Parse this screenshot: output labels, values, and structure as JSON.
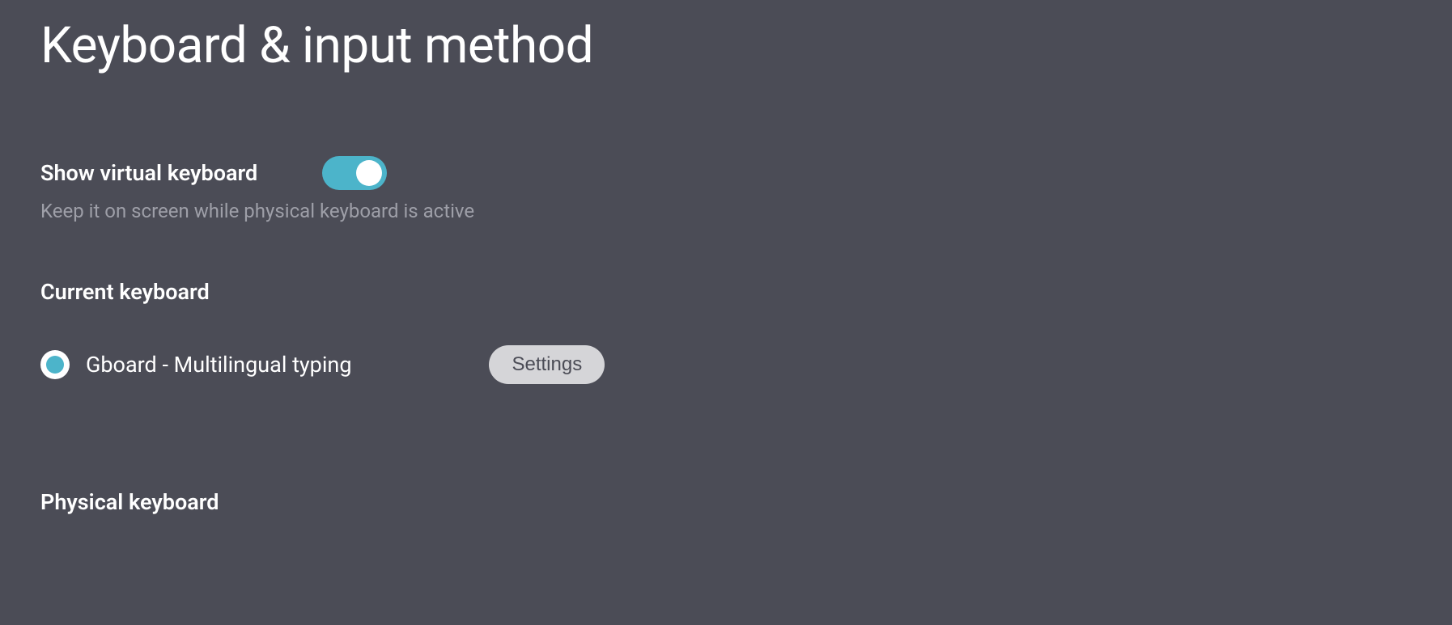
{
  "page": {
    "title": "Keyboard & input method"
  },
  "virtualKeyboard": {
    "title": "Show virtual keyboard",
    "description": "Keep it on screen while physical keyboard is active",
    "enabled": true
  },
  "currentKeyboard": {
    "sectionTitle": "Current keyboard",
    "selected": {
      "label": "Gboard - Multilingual typing"
    },
    "settingsButton": "Settings"
  },
  "physicalKeyboard": {
    "sectionTitle": "Physical keyboard"
  }
}
